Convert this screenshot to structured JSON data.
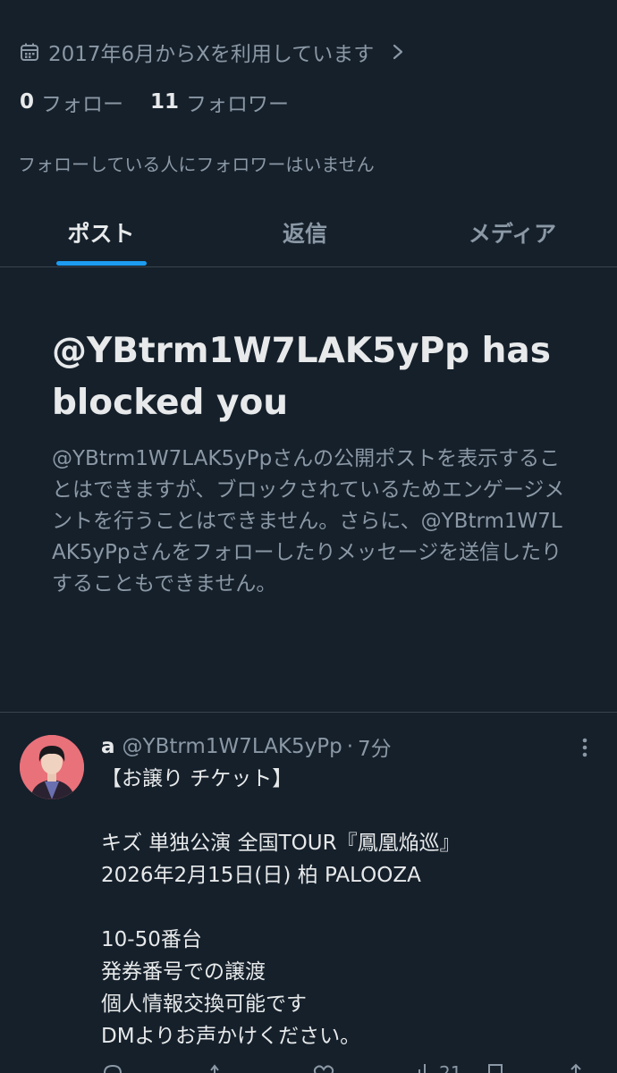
{
  "profile": {
    "joined_text": "2017年6月からXを利用しています",
    "following_count": "0",
    "following_label": "フォロー",
    "followers_count": "11",
    "followers_label": "フォロワー",
    "mutual_text": "フォローしている人にフォロワーはいません"
  },
  "tabs": [
    {
      "label": "ポスト",
      "active": true
    },
    {
      "label": "返信",
      "active": false
    },
    {
      "label": "メディア",
      "active": false
    }
  ],
  "blocked": {
    "title": "@YBtrm1W7LAK5yPp has blocked you",
    "body": "@YBtrm1W7LAK5yPpさんの公開ポストを表示することはできますが、ブロックされているためエンゲージメントを行うことはできません。さらに、@YBtrm1W7LAK5yPpさんをフォローしたりメッセージを送信したりすることもできません。"
  },
  "post": {
    "name": "a",
    "handle": "@YBtrm1W7LAK5yPp",
    "time": "7分",
    "lines": [
      "【お譲り チケット】",
      "",
      "キズ 単独公演 全国TOUR『鳳凰焔巡』",
      "2026年2月15日(日) 柏 PALOOZA",
      "",
      "10-50番台",
      "発券番号での譲渡",
      "個人情報交換可能です",
      "DMよりお声かけください。"
    ],
    "views": "21"
  },
  "colors": {
    "background": "#15202b",
    "accent": "#1d9bf0",
    "text": "#e7e9ea",
    "muted": "#8b98a5",
    "border": "#38444d"
  },
  "icons": {
    "joined": "calendar-icon",
    "chevron": "chevron-right-icon",
    "more": "more-vertical-icon"
  }
}
